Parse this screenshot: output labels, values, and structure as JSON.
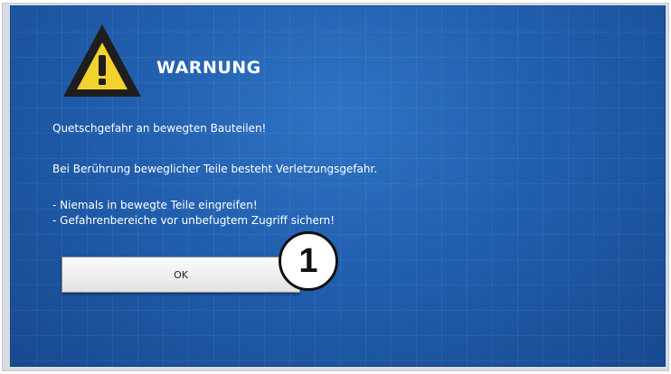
{
  "dialog": {
    "title": "WARNUNG",
    "icon": "warning-triangle-icon",
    "message_lines": [
      "Quetschgefahr an bewegten Bauteilen!",
      "Bei Berührung beweglicher Teile besteht Verletzungsgefahr.",
      "- Niemals in bewegte Teile eingreifen!",
      "- Gefahrenbereiche vor unbefugtem Zugriff sichern!"
    ],
    "ok_label": "OK"
  },
  "callout": {
    "label": "1"
  },
  "colors": {
    "dialog_background": "#215fae",
    "warning_yellow": "#f2d22c",
    "text": "#ffffff"
  }
}
